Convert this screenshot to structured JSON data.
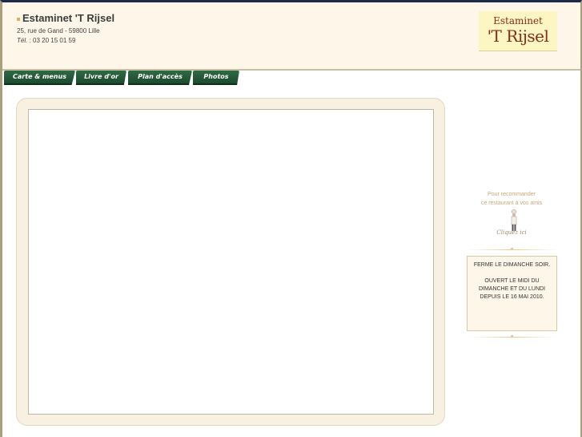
{
  "header": {
    "title": "Estaminet 'T Rijsel",
    "address": "25, rue de Gand - 59800 Lille",
    "phone_label": "Tél.",
    "phone": " : 03 20 15 01 59",
    "logo_line1": "Estaminet",
    "logo_line2": "'T Rijsel"
  },
  "nav": {
    "tabs": [
      {
        "label": "Carte & menus"
      },
      {
        "label": "Livre d'or"
      },
      {
        "label": "Plan d'accès"
      },
      {
        "label": "Photos"
      }
    ]
  },
  "sidebar": {
    "recommend_line1": "Pour recommander",
    "recommend_line2": "ce restaurant à vos amis",
    "click_here": "Cliquez ici",
    "notice": {
      "line1": "FERME LE DIMANCHE SOIR.",
      "line2": "OUVERT LE MIDI DU",
      "line3": "DIMANCHE ET DU LUNDI",
      "line4": "DEPUIS LE 16 MAI 2010."
    }
  },
  "colors": {
    "header_bg": "#fdf6e9",
    "tab_green": "#2f6a45",
    "logo_bg": "#fbf6c2",
    "logo_text": "#8a2a1a",
    "top_border": "#1e2a4a"
  }
}
